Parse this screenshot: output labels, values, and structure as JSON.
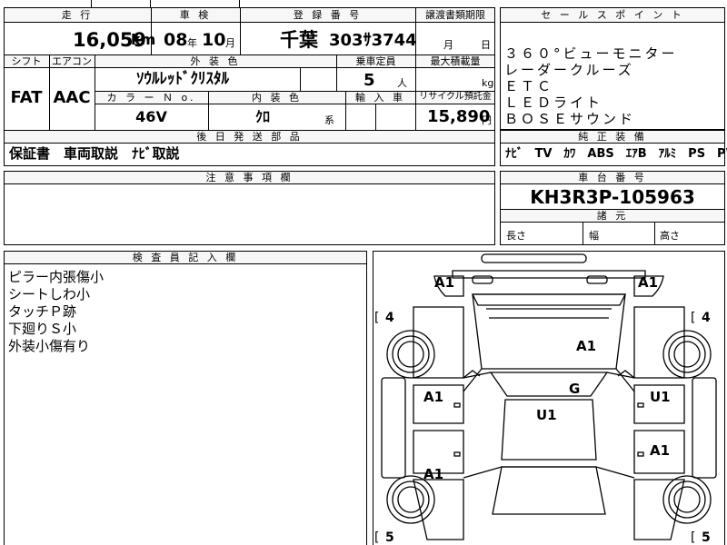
{
  "main_table": {
    "labels": {
      "mileage": "走 行",
      "inspection": "車 検",
      "registration": "登 録 番 号",
      "transfer_period": "譲渡書類期限",
      "shift": "シフト",
      "aircon": "エアコン",
      "exterior_color": "外 装 色",
      "capacity": "乗車定員",
      "max_load": "最大積載量",
      "color_no": "カ ラ ー Ｎ o.",
      "interior_color": "内 装 色",
      "import": "輸 入 車",
      "recycle": "リサイクル預託金",
      "later_parts": "後 日 発 送 部 品"
    },
    "mileage_value": "16,059",
    "mileage_unit": "km",
    "inspection_year": "08",
    "inspection_year_unit": "年",
    "inspection_month": "10",
    "inspection_month_unit": "月",
    "registration_region": "千葉",
    "registration_number": "303ｻ3744",
    "transfer_month_unit": "月",
    "transfer_day_unit": "日",
    "shift_value": "FAT",
    "aircon_value": "AAC",
    "exterior_color_value": "ｿｳﾙﾚｯﾄﾞｸﾘｽﾀﾙ",
    "capacity_value": "5",
    "capacity_unit": "人",
    "max_load_unit": "kg",
    "color_no_value": "46V",
    "interior_color_value": "ｸﾛ",
    "interior_color_suffix": "系",
    "recycle_value": "15,890",
    "recycle_unit": "円",
    "later_parts_value": "保証書　車両取説　ﾅﾋﾞ取説"
  },
  "sales_points": {
    "header": "セ ー ル ス ポ イ ン ト",
    "items": [
      "３６０°ビューモニター",
      "レーダークルーズ",
      "ＥＴＣ",
      "ＬＥＤライト",
      "ＢＯＳＥサウンド"
    ]
  },
  "genuine_equipment": {
    "header": "純 正 装 備",
    "value": "ﾅﾋﾞ　TV　ｶﾜ　ABS　ｴｱB　ｱﾙﾐ　PS　PW"
  },
  "notice": {
    "header": "注 意 事 項 欄"
  },
  "chassis": {
    "header": "車 台 番 号",
    "number": "KH3R3P-105963",
    "dims_header": "諸 元",
    "length_label": "長さ",
    "width_label": "幅",
    "height_label": "高さ"
  },
  "inspector": {
    "header": "検 査 員 記 入 欄",
    "notes": [
      "ピラー内張傷小",
      "シートしわ小",
      "タッチＰ跡",
      "下廻りＳ小",
      "外装小傷有り"
    ]
  },
  "diagram": {
    "marks": {
      "front_left": "A1",
      "front_right": "A1",
      "hood": "A1",
      "windshield": "G",
      "roof": "U1",
      "left_front_door": "A1",
      "right_front_door": "U1",
      "right_rear_door": "A1",
      "left_rear_door": "A1"
    },
    "tire_front_left": "4",
    "tire_front_right": "4",
    "tire_rear_left": "5",
    "tire_rear_right": "5"
  }
}
